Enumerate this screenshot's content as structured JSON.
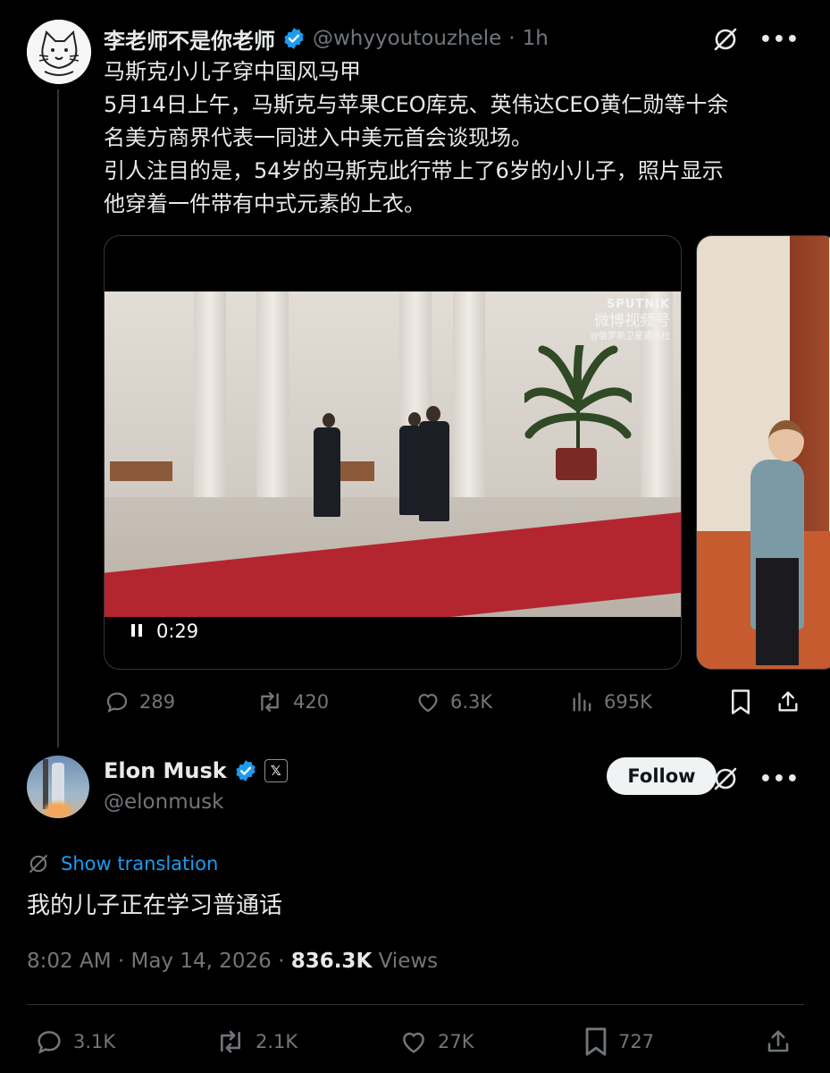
{
  "parent_tweet": {
    "author_name": "李老师不是你老师",
    "handle": "@whyyoutouzhele",
    "separator": "·",
    "time_ago": "1h",
    "text_lines": [
      "马斯克小儿子穿中国风马甲",
      "5月14日上午，马斯克与苹果CEO库克、英伟达CEO黄仁勋等十余",
      "名美方商界代表一同进入中美元首会谈现场。",
      "引人注目的是，54岁的马斯克此行带上了6岁的小儿子，照片显示",
      "他穿着一件带有中式元素的上衣。"
    ],
    "video": {
      "duration": "0:29",
      "watermark_brand": "SPUTNIK",
      "watermark_cn": "微博视频号",
      "watermark_sub": "@俄罗斯卫星通讯社"
    },
    "actions": {
      "replies": "289",
      "reposts": "420",
      "likes": "6.3K",
      "views": "695K"
    }
  },
  "main_tweet": {
    "author_name": "Elon Musk",
    "badge": "𝕏",
    "handle": "@elonmusk",
    "follow_label": "Follow",
    "show_translation": "Show translation",
    "text": "我的儿子正在学习普通话",
    "timestamp": "8:02 AM · May 14, 2026 · ",
    "views_count": "836.3K",
    "views_label": " Views",
    "actions": {
      "replies": "3.1K",
      "reposts": "2.1K",
      "likes": "27K",
      "bookmarks": "727"
    }
  },
  "colors": {
    "background": "#000000",
    "text": "#e7e9ea",
    "secondary": "#71767b",
    "accent": "#1d9bf0",
    "follow_bg": "#eff3f4"
  }
}
